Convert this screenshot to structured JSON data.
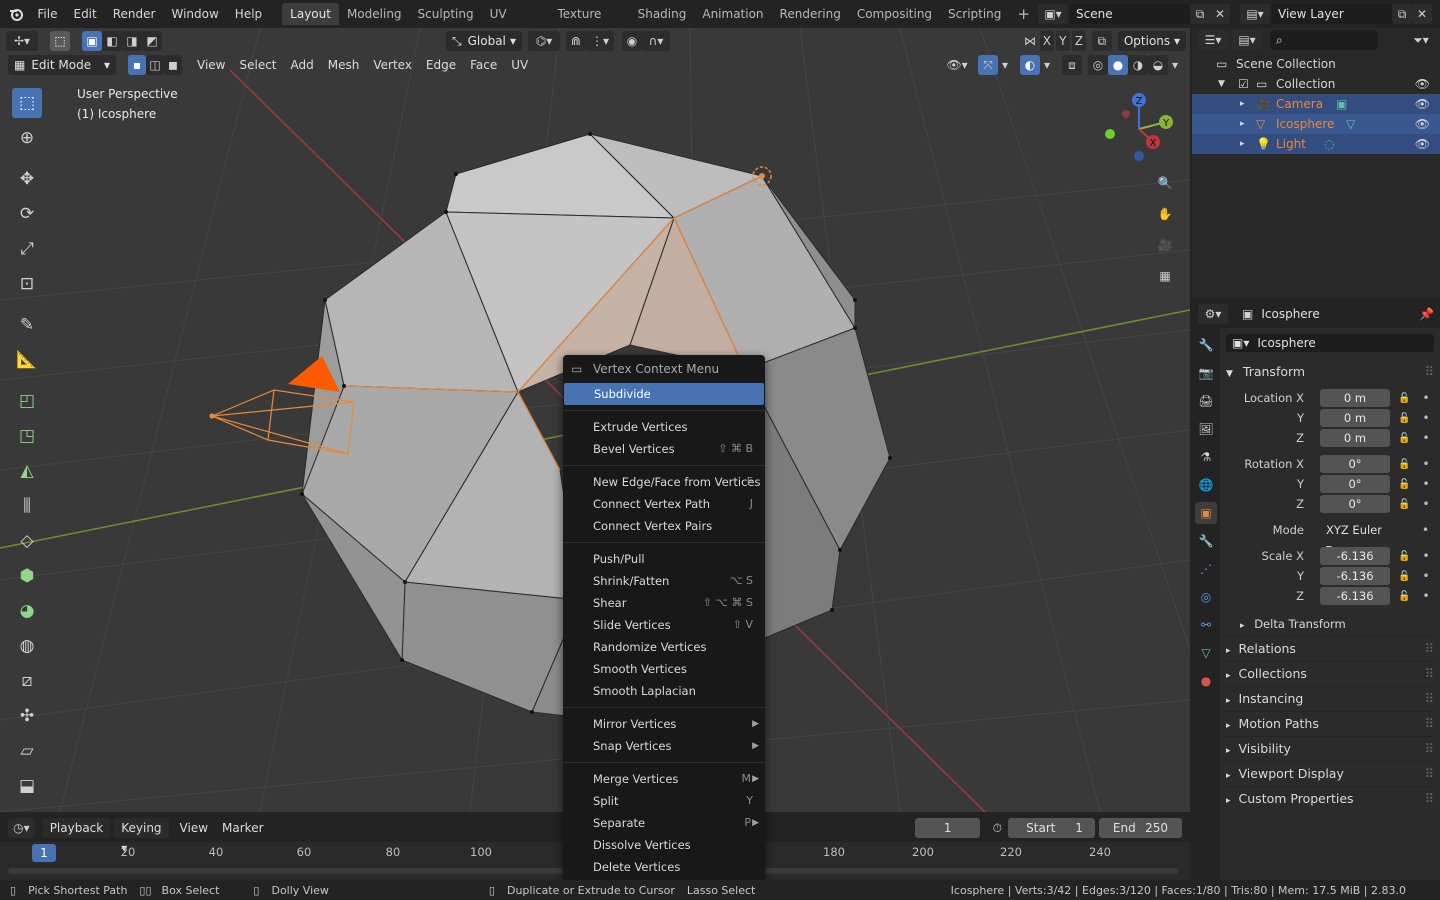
{
  "topbar": {
    "menus": [
      "File",
      "Edit",
      "Render",
      "Window",
      "Help"
    ],
    "workspaces": [
      "Layout",
      "Modeling",
      "Sculpting",
      "UV Editing",
      "Texture Paint",
      "Shading",
      "Animation",
      "Rendering",
      "Compositing",
      "Scripting"
    ],
    "active_workspace": "Layout",
    "add_tab": "+",
    "scene": "Scene",
    "view_layer": "View Layer"
  },
  "viewport_header": {
    "transform_orientation": "Global",
    "axes": [
      "X",
      "Y",
      "Z"
    ],
    "options": "Options",
    "mode": "Edit Mode",
    "menus": [
      "View",
      "Select",
      "Add",
      "Mesh",
      "Vertex",
      "Edge",
      "Face",
      "UV"
    ]
  },
  "viewport": {
    "perspective_label": "User Perspective",
    "object_label": "(1) Icosphere",
    "gizmo": {
      "x": "X",
      "y": "Y",
      "z": "Z"
    }
  },
  "context_menu": {
    "title": "Vertex Context Menu",
    "groups": [
      [
        {
          "label": "Subdivide",
          "highlight": true
        }
      ],
      [
        {
          "label": "Extrude Vertices"
        },
        {
          "label": "Bevel Vertices",
          "shortcut": "⇧ ⌘ B"
        }
      ],
      [
        {
          "label": "New Edge/Face from Vertices",
          "shortcut": "F"
        },
        {
          "label": "Connect Vertex Path",
          "shortcut": "J"
        },
        {
          "label": "Connect Vertex Pairs"
        }
      ],
      [
        {
          "label": "Push/Pull"
        },
        {
          "label": "Shrink/Fatten",
          "shortcut": "⌥ S"
        },
        {
          "label": "Shear",
          "shortcut": "⇧ ⌥ ⌘ S"
        },
        {
          "label": "Slide Vertices",
          "shortcut": "⇧ V"
        },
        {
          "label": "Randomize Vertices"
        },
        {
          "label": "Smooth Vertices"
        },
        {
          "label": "Smooth Laplacian"
        }
      ],
      [
        {
          "label": "Mirror Vertices",
          "submenu": true
        },
        {
          "label": "Snap Vertices",
          "submenu": true
        }
      ],
      [
        {
          "label": "Merge Vertices",
          "shortcut": "M",
          "submenu": true
        },
        {
          "label": "Split",
          "shortcut": "Y"
        },
        {
          "label": "Separate",
          "shortcut": "P",
          "submenu": true
        },
        {
          "label": "Dissolve Vertices"
        },
        {
          "label": "Delete Vertices"
        }
      ]
    ]
  },
  "outliner": {
    "root": "Scene Collection",
    "collection": "Collection",
    "items": [
      {
        "name": "Camera",
        "color": "#e8883a"
      },
      {
        "name": "Icosphere",
        "color": "#e8883a"
      },
      {
        "name": "Light",
        "color": "#e8883a"
      }
    ]
  },
  "properties": {
    "object_name": "Icosphere",
    "datablock": "Icosphere",
    "transform_title": "Transform",
    "location_label": "Location X",
    "rotation_label": "Rotation X",
    "scale_label": "Scale X",
    "y_label": "Y",
    "z_label": "Z",
    "location": [
      "0 m",
      "0 m",
      "0 m"
    ],
    "rotation": [
      "0°",
      "0°",
      "0°"
    ],
    "mode_label": "Mode",
    "mode_value": "XYZ Euler",
    "scale": [
      "-6.136",
      "-6.136",
      "-6.136"
    ],
    "delta_transform": "Delta Transform",
    "panels": [
      "Relations",
      "Collections",
      "Instancing",
      "Motion Paths",
      "Visibility",
      "Viewport Display",
      "Custom Properties"
    ]
  },
  "timeline": {
    "menus": [
      "Playback",
      "Keying",
      "View",
      "Marker"
    ],
    "current_frame": "1",
    "start_label": "Start",
    "start": "1",
    "end_label": "End",
    "end": "250",
    "ruler": [
      "20",
      "40",
      "60",
      "80",
      "100",
      "180",
      "200",
      "220",
      "240"
    ],
    "ruler_current": "1"
  },
  "statusbar": {
    "left": [
      {
        "label": "Pick Shortest Path"
      },
      {
        "label": "Box Select"
      },
      {
        "label": "Dolly View"
      },
      {
        "label": "Duplicate or Extrude to Cursor"
      },
      {
        "label": "Lasso Select"
      }
    ],
    "right": "Icosphere | Verts:3/42 | Edges:3/120 | Faces:1/80 | Tris:80 | Mem: 17.5 MiB | 2.83.0"
  },
  "colors": {
    "accent": "#4772b3",
    "selection_orange": "#e8883a",
    "axis_x": "#c0353b",
    "axis_y": "#8db13a"
  }
}
